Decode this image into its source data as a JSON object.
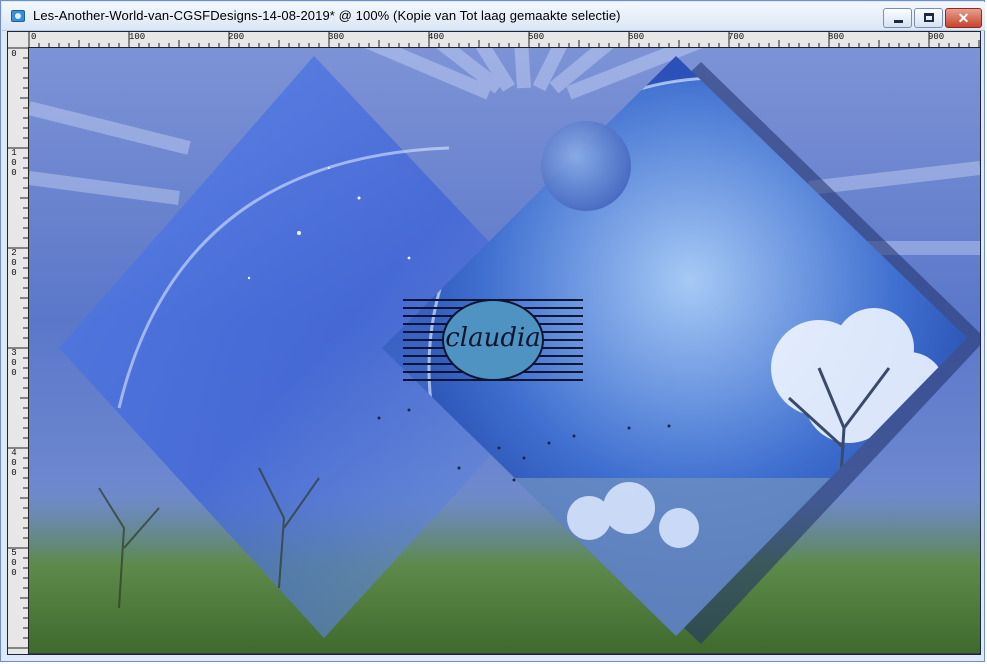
{
  "window": {
    "title": "Les-Another-World-van-CGSFDesigns-14-08-2019* @ 100% (Kopie van Tot laag gemaakte selectie)",
    "controls": {
      "minimize": "minimize",
      "maximize": "maximize",
      "close": "✕"
    }
  },
  "ruler": {
    "horizontal_labels": [
      "0",
      "100",
      "200",
      "300",
      "400",
      "500",
      "600",
      "700",
      "800",
      "900"
    ],
    "vertical_labels": [
      "0",
      "100",
      "200",
      "300",
      "400",
      "500"
    ]
  },
  "image": {
    "watermark_text": "claudia",
    "colors": {
      "sky": "#3e63c8",
      "light": "#a9c4f4",
      "grass": "#5f8a44",
      "dark": "#0d1940"
    }
  }
}
